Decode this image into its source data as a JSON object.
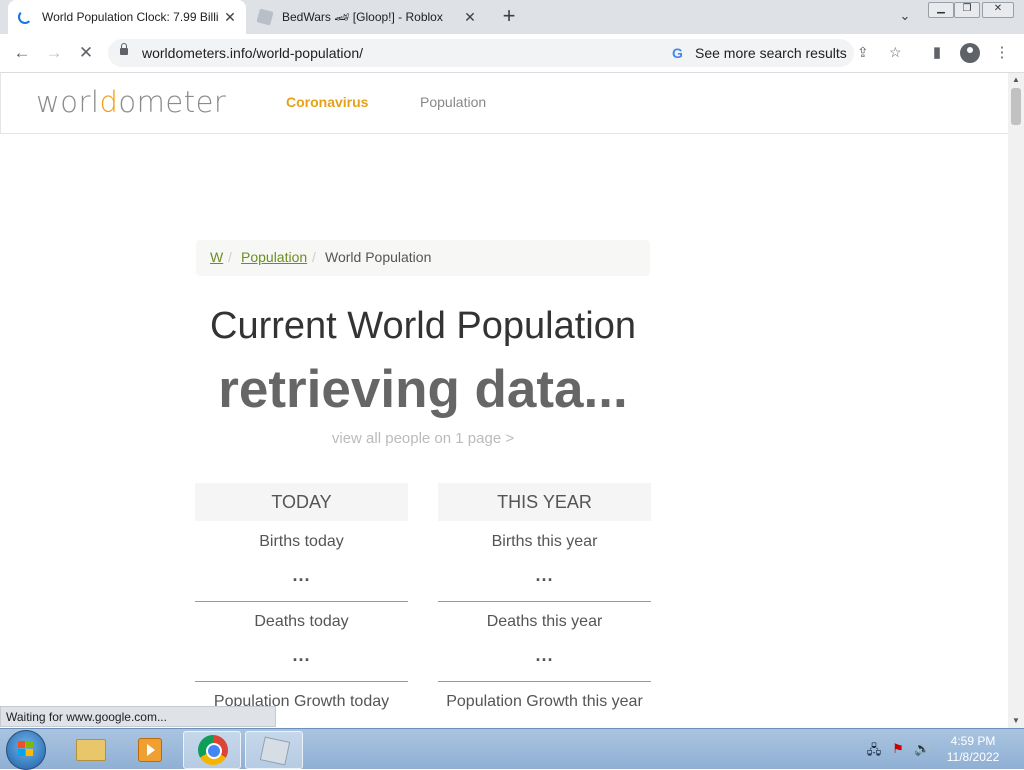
{
  "browser": {
    "tabs": [
      {
        "title": "World Population Clock: 7.99 Billi",
        "close": "✕"
      },
      {
        "title": "BedWars 🏎 [Gloop!] - Roblox",
        "close": "✕"
      }
    ],
    "new_tab": "+",
    "url": "worldometers.info/world-population/",
    "search_chip": "See more search results",
    "google_g": "G",
    "status": "Waiting for www.google.com..."
  },
  "site": {
    "logo_left": "worl",
    "logo_o": "d",
    "logo_right": "ometer",
    "nav": {
      "coronavirus": "Coronavirus",
      "population": "Population"
    }
  },
  "breadcrumb": {
    "home": "W",
    "sep": "/",
    "population": "Population",
    "current": "World Population"
  },
  "main": {
    "heading": "Current World Population",
    "counter": "retrieving data...",
    "view_all": "view all people on 1 page >"
  },
  "stats": {
    "today": {
      "header": "TODAY",
      "births_label": "Births today",
      "births_value": "...",
      "deaths_label": "Deaths today",
      "deaths_value": "...",
      "growth_label": "Population Growth today"
    },
    "year": {
      "header": "THIS YEAR",
      "births_label": "Births this year",
      "births_value": "...",
      "deaths_label": "Deaths this year",
      "deaths_value": "...",
      "growth_label": "Population Growth this year"
    }
  },
  "taskbar": {
    "time": "4:59 PM",
    "date": "11/8/2022"
  }
}
